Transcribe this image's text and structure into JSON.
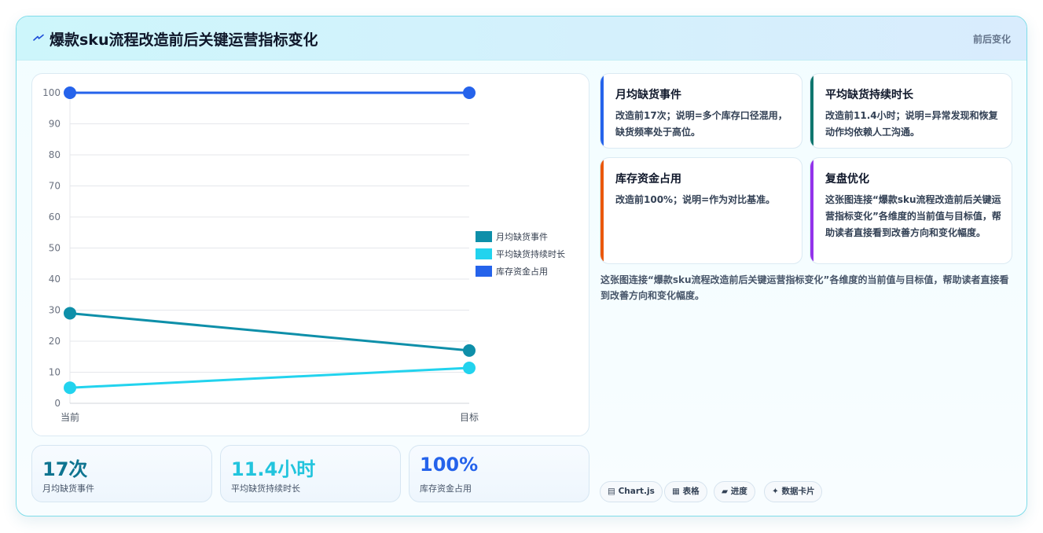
{
  "header": {
    "icon": "lightning-icon",
    "title": "爆款sku流程改造前后关键运营指标变化",
    "tag": "前后变化"
  },
  "chart_data": {
    "type": "line",
    "categories": [
      "当前",
      "目标"
    ],
    "ylim": [
      0,
      100
    ],
    "yticks": [
      0,
      10,
      20,
      30,
      40,
      50,
      60,
      70,
      80,
      90,
      100
    ],
    "grid": true,
    "legend_position": "right",
    "series": [
      {
        "name": "月均缺货事件",
        "values": [
          29,
          17
        ],
        "color": "#0e8fa9"
      },
      {
        "name": "平均缺货持续时长",
        "values": [
          5,
          11.4
        ],
        "color": "#22d3ee"
      },
      {
        "name": "库存资金占用",
        "values": [
          100,
          100
        ],
        "color": "#2563eb"
      }
    ]
  },
  "stats": [
    {
      "value": "17次",
      "label": "月均缺货事件",
      "color": "#0e7490"
    },
    {
      "value": "11.4小时",
      "label": "平均缺货持续时长",
      "color": "#22c4dd"
    },
    {
      "value": "100%",
      "label": "库存资金占用",
      "color": "#2563eb"
    }
  ],
  "cards": [
    {
      "title": "月均缺货事件",
      "desc": "改造前17次；说明=多个库存口径混用，缺货频率处于高位。",
      "color": "#2563eb"
    },
    {
      "title": "平均缺货持续时长",
      "desc": "改造前11.4小时；说明=异常发现和恢复动作均依赖人工沟通。",
      "color": "#0f766e"
    },
    {
      "title": "库存资金占用",
      "desc": "改造前100%；说明=作为对比基准。",
      "color": "#ea580c"
    },
    {
      "title": "复盘优化",
      "desc": "这张图连接“爆款sku流程改造前后关键运营指标变化”各维度的当前值与目标值，帮助读者直接看到改善方向和变化幅度。",
      "color": "#9333ea"
    }
  ],
  "summary": "这张图连接“爆款sku流程改造前后关键运营指标变化”各维度的当前值与目标值，帮助读者直接看到改善方向和变化幅度。",
  "chips": [
    {
      "icon": "chart-icon",
      "label": "Chart.js"
    },
    {
      "icon": "table-icon",
      "label": "表格"
    },
    {
      "icon": "progress-icon",
      "label": "进度"
    },
    {
      "icon": "sparkle-icon",
      "label": "数据卡片"
    }
  ]
}
